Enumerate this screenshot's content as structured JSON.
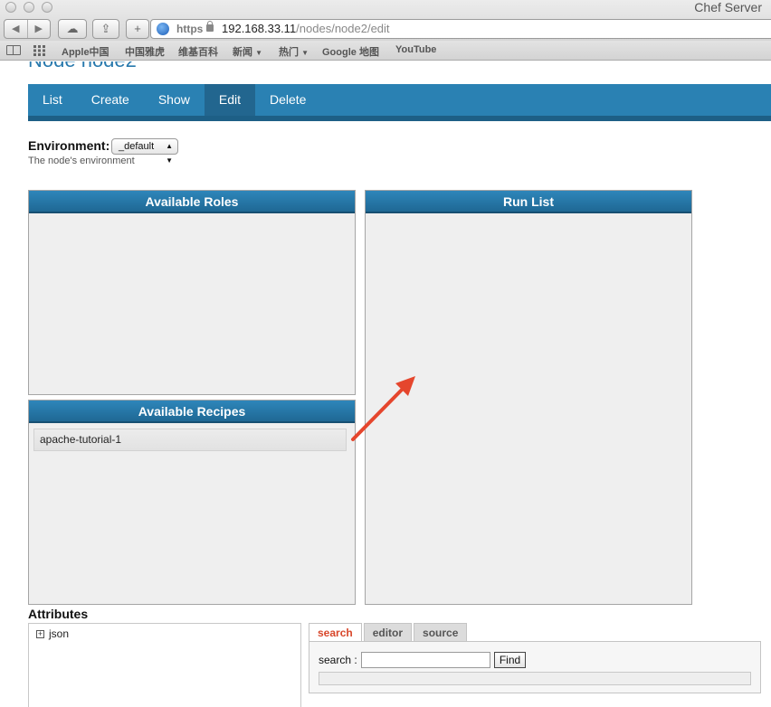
{
  "browser": {
    "window_title": "Chef Server",
    "back_glyph": "◀",
    "forward_glyph": "▶",
    "cloud_glyph": "☁",
    "share_glyph": "⇪",
    "add_glyph": "+",
    "url_scheme": "https",
    "url_host": "192.168.33.11",
    "url_path": "/nodes/node2/edit"
  },
  "bookmarks": {
    "items": [
      {
        "label": "Apple中国"
      },
      {
        "label": "中国雅虎"
      },
      {
        "label": "维基百科"
      },
      {
        "label": "新闻",
        "caret": "▼"
      },
      {
        "label": "热门",
        "caret": "▼"
      },
      {
        "label": "Google 地图"
      },
      {
        "label": "YouTube"
      }
    ]
  },
  "page": {
    "title": "Node node2",
    "tabs": [
      {
        "label": "List"
      },
      {
        "label": "Create"
      },
      {
        "label": "Show"
      },
      {
        "label": "Edit",
        "active": true
      },
      {
        "label": "Delete"
      }
    ],
    "environment": {
      "label": "Environment:",
      "value": "_default",
      "help": "The node's environment"
    },
    "available_roles": {
      "title": "Available Roles"
    },
    "available_recipes": {
      "title": "Available Recipes",
      "items": [
        "apache-tutorial-1"
      ]
    },
    "run_list": {
      "title": "Run List"
    },
    "attributes": {
      "title": "Attributes",
      "tree_root": "json",
      "expand_glyph": "+",
      "tabs": [
        {
          "label": "search",
          "active": true
        },
        {
          "label": "editor"
        },
        {
          "label": "source"
        }
      ],
      "search_label": "search :",
      "search_value": "",
      "find_label": "Find"
    }
  },
  "colors": {
    "tab_bar": "#2a81b3",
    "panel_header": "#2e86ba",
    "arrow": "#e5462d",
    "active_search_tab": "#d8472b"
  }
}
